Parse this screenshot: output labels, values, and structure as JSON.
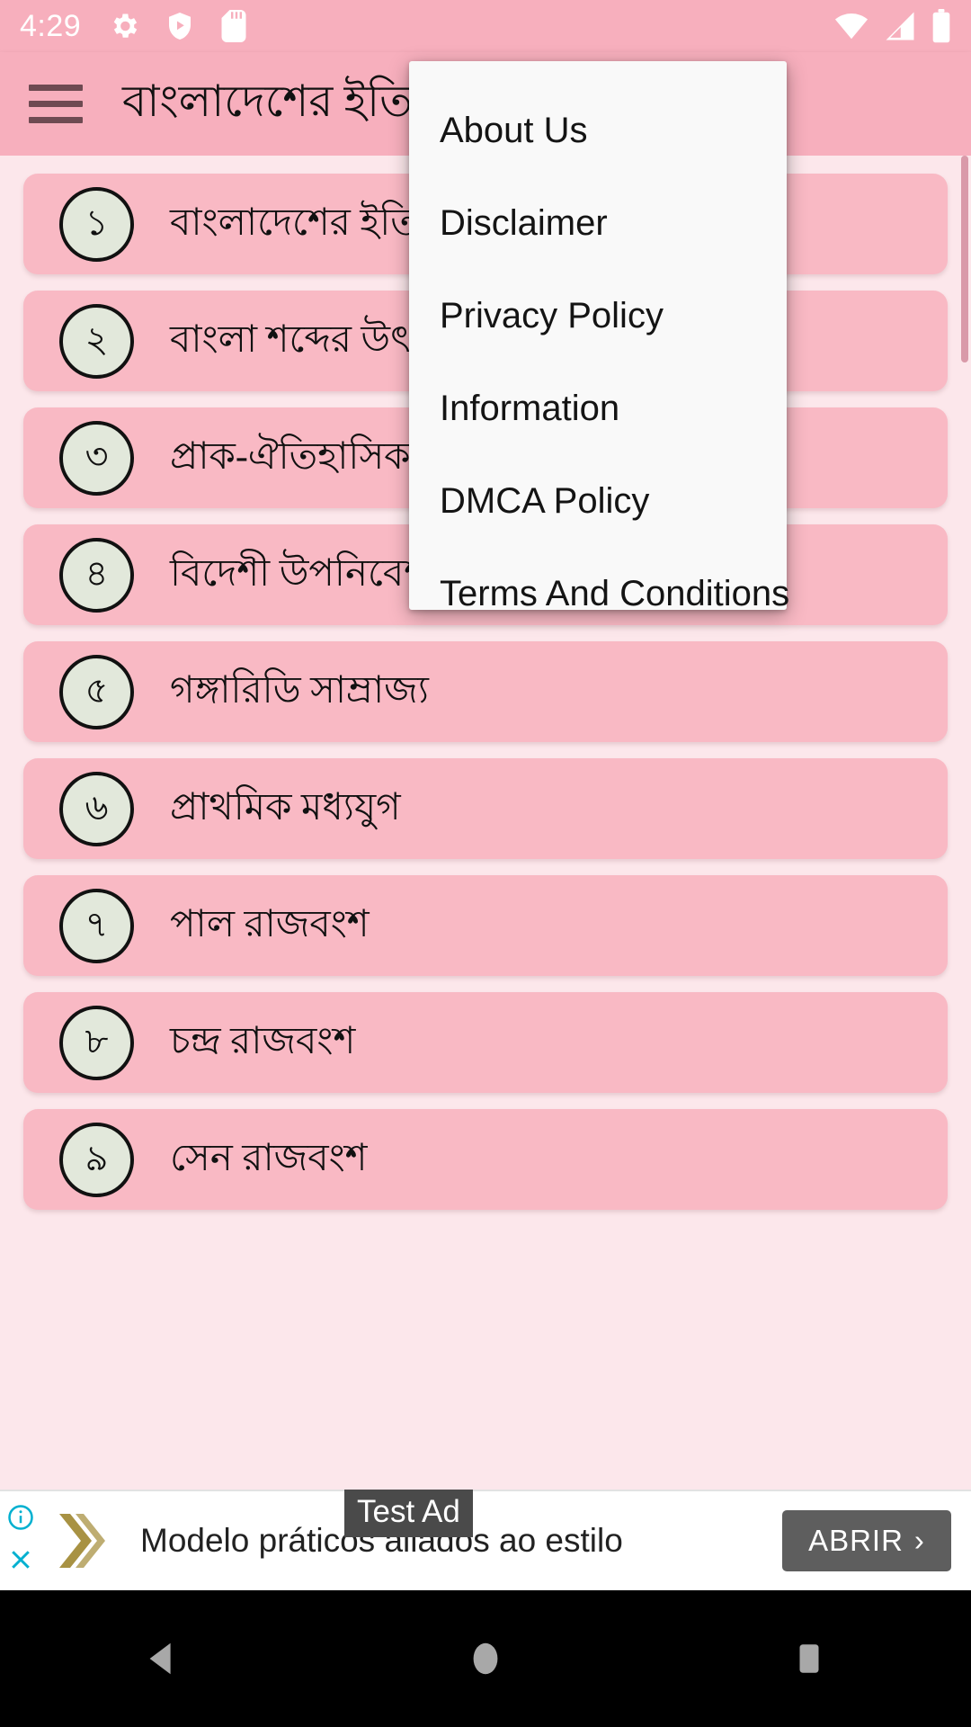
{
  "status_bar": {
    "time": "4:29",
    "left_icons": [
      "gear-icon",
      "play-protect-shield-icon",
      "sd-card-icon"
    ],
    "right_icons": [
      "wifi-icon",
      "cellular-signal-icon",
      "battery-icon"
    ],
    "background_color": "#f7afbd",
    "icon_color": "#ffffff"
  },
  "app_bar": {
    "menu_icon": "hamburger-menu-icon",
    "title": "বাংলাদেশের ইতিহাস",
    "background_color": "#f7afbd",
    "title_color": "#111111"
  },
  "overflow_menu": {
    "visible": true,
    "background_color": "#f9f9f9",
    "items": [
      {
        "label": "About Us"
      },
      {
        "label": "Disclaimer"
      },
      {
        "label": "Privacy Policy"
      },
      {
        "label": "Information"
      },
      {
        "label": "DMCA Policy"
      },
      {
        "label": "Terms And Conditions"
      }
    ]
  },
  "list": {
    "background_color": "#fce7eb",
    "card_color": "#f9b9c4",
    "badge_color": "#e2e8db",
    "rows": [
      {
        "number": "১",
        "label": "বাংলাদেশের ইতিহাস"
      },
      {
        "number": "২",
        "label": "বাংলা শব্দের উৎপত্তি"
      },
      {
        "number": "৩",
        "label": "প্রাক-ঐতিহাসিক বাংলা"
      },
      {
        "number": "৪",
        "label": "বিদেশী উপনিবেশকরণ"
      },
      {
        "number": "৫",
        "label": "গঙ্গারিডি সাম্রাজ্য"
      },
      {
        "number": "৬",
        "label": "প্রাথমিক মধ্যযুগ"
      },
      {
        "number": "৭",
        "label": "পাল রাজবংশ"
      },
      {
        "number": "৮",
        "label": "চন্দ্র রাজবংশ"
      },
      {
        "number": "৯",
        "label": "সেন রাজবংশ"
      }
    ]
  },
  "ad_banner": {
    "test_badge": "Test Ad",
    "headline": "Modelo práticos aliados ao estilo",
    "cta_label": "ABRIR",
    "cta_chevron": "›",
    "info_icon": "info-circle-icon",
    "close_icon": "close-x-icon",
    "advertiser_logo": "gold-chevron-logo",
    "accent_color": "#00b0d0",
    "cta_background": "#5e5e5e"
  },
  "nav_bar": {
    "background_color": "#000000",
    "icon_color": "#a8a8a8",
    "buttons": [
      {
        "name": "back-button"
      },
      {
        "name": "home-button"
      },
      {
        "name": "recents-button"
      }
    ]
  }
}
